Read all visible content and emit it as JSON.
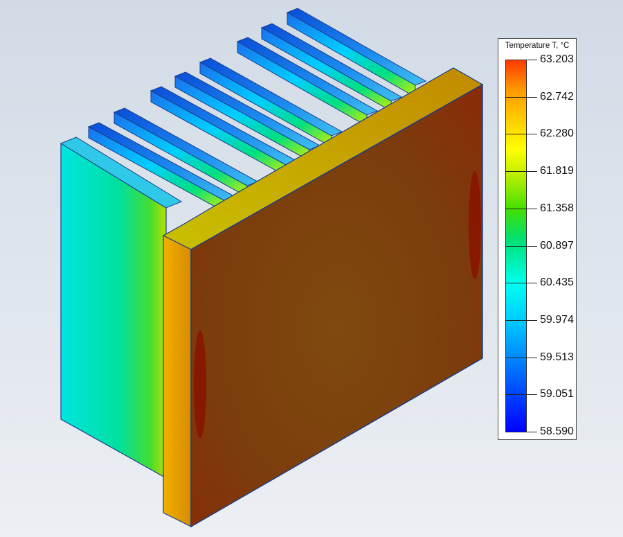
{
  "legend": {
    "title": "Temperature T, °C",
    "ticks": [
      "63.203",
      "62.742",
      "62.280",
      "61.819",
      "61.358",
      "60.897",
      "60.435",
      "59.974",
      "59.513",
      "59.051",
      "58.590"
    ],
    "min": 58.59,
    "max": 63.203,
    "colormap": [
      "#0000ff",
      "#00ccff",
      "#00e070",
      "#ffff00",
      "#ff3a00"
    ]
  },
  "model": {
    "fin_count": 10,
    "base_color": "#7a3a0c",
    "fin_root_color": "#d9b800"
  }
}
